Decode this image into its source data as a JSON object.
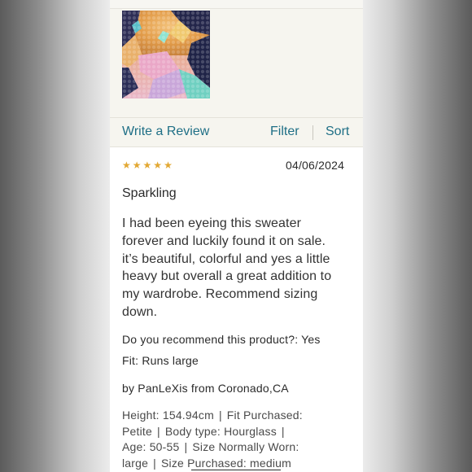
{
  "action_bar": {
    "write_review": "Write a Review",
    "filter": "Filter",
    "sort": "Sort"
  },
  "review": {
    "rating": 5,
    "stars": [
      "★",
      "★",
      "★",
      "★",
      "★"
    ],
    "date": "04/06/2024",
    "title": "Sparkling",
    "body_lines": [
      "I had been eyeing this sweater",
      "forever and luckily found it on sale.",
      "it’s beautiful, colorful and yes a little",
      "heavy but overall a great addition to",
      "my wardrobe. Recommend sizing",
      "down."
    ],
    "recommend": "Do you recommend this product?: Yes",
    "fit": "Fit: Runs large",
    "byline": "by PanLeXis from Coronado,CA",
    "details": {
      "height": "Height: 154.94cm",
      "fit_purchased_label": "Fit Purchased:",
      "fit_purchased_value": "Petite",
      "body_type": "Body type: Hourglass",
      "age": "Age: 50-55",
      "size_normally_worn_label": "Size Normally Worn:",
      "size_normally_worn_value": "large",
      "size_purchased": "Size Purchased: medium",
      "separator": "|"
    }
  },
  "colors": {
    "link": "#1f6f86",
    "star": "#e2a833",
    "panel_bg": "#f6f5ef",
    "text": "#2b2b2b"
  },
  "icons": {
    "star": "star-icon",
    "photo": "sequin-sweater-photo"
  }
}
